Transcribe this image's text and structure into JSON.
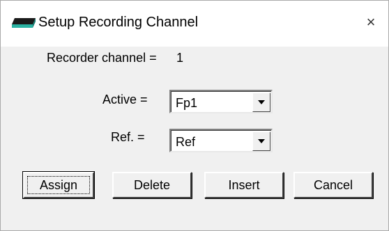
{
  "window": {
    "title": "Setup Recording Channel",
    "close_glyph": "×",
    "icon": "recorder-device-icon"
  },
  "channel": {
    "label": "Recorder channel =",
    "value": "1"
  },
  "active": {
    "label": "Active =",
    "value": "Fp1"
  },
  "ref": {
    "label": "Ref. =",
    "value": "Ref"
  },
  "buttons": {
    "assign": "Assign",
    "delete": "Delete",
    "insert": "Insert",
    "cancel": "Cancel"
  },
  "colors": {
    "dialog_bg": "#f0f0f0",
    "titlebar_bg": "#ffffff",
    "icon_teal": "#2bb3a3"
  }
}
